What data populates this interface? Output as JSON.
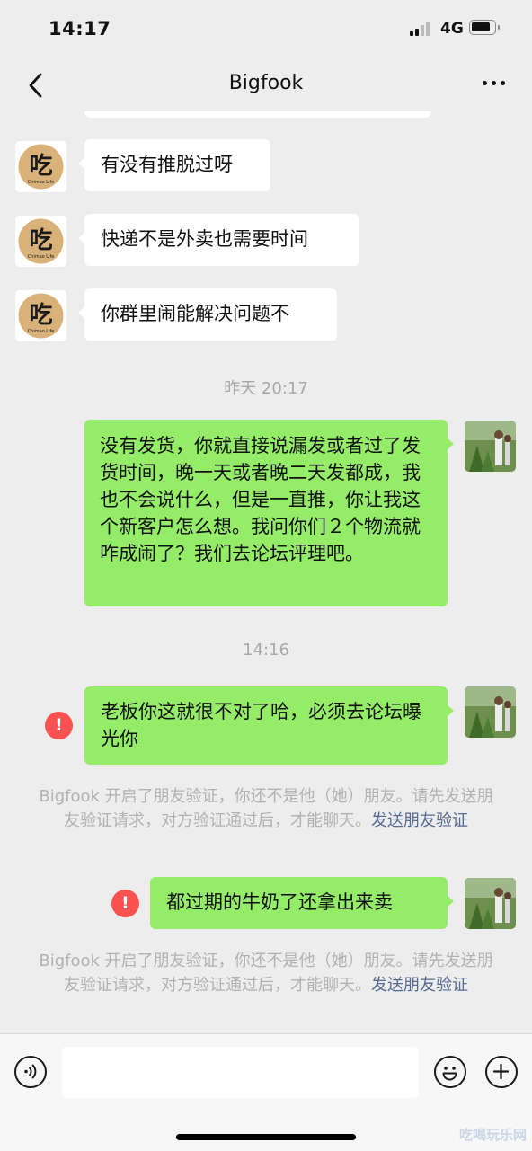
{
  "status_bar": {
    "time": "14:17",
    "network": "4G"
  },
  "nav": {
    "title": "Bigfook"
  },
  "messages": {
    "in1": "有没有推脱过呀",
    "in2": "快递不是外卖也需要时间",
    "in3": "你群里闹能解决问题不",
    "ts1": "昨天 20:17",
    "out1": "没有发货，你就直接说漏发或者过了发货时间，晚一天或者晚二天发都成，我也不会说什么，但是一直推，你让我这个新客户怎么想。我问你们２个物流就咋成闹了？我们去论坛评理吧。",
    "ts2": "14:16",
    "out2": "老板你这就很不对了哈，必须去论坛曝光你",
    "out3": "都过期的牛奶了还拿出来卖"
  },
  "system_notice": {
    "text": "Bigfook 开启了朋友验证，你还不是他（她）朋友。请先发送朋友验证请求，对方验证通过后，才能聊天。",
    "link": "发送朋友验证"
  },
  "error_mark": "!",
  "contact_avatar": {
    "glyph": "吃",
    "subtext": "Chimao Life"
  },
  "watermark": "吃喝玩乐网",
  "colors": {
    "outgoing_bubble": "#95ec69",
    "incoming_bubble": "#ffffff",
    "error": "#fa5151",
    "link": "#576b95",
    "background": "#ededed"
  },
  "icons": [
    "back-arrow-icon",
    "more-dots-icon",
    "voice-icon",
    "emoji-icon",
    "plus-icon",
    "error-icon",
    "signal-icon",
    "battery-icon"
  ]
}
